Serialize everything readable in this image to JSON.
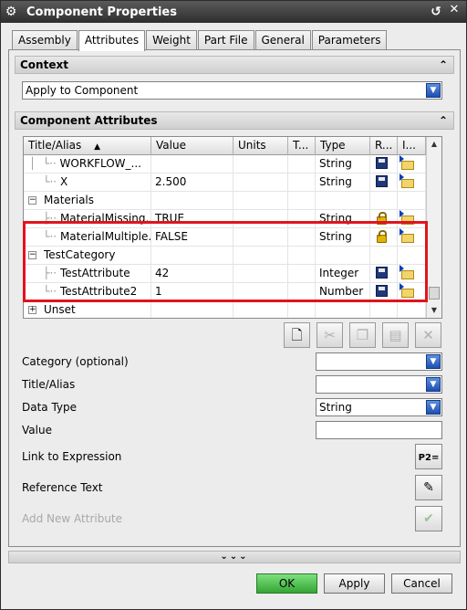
{
  "window": {
    "title": "Component Properties"
  },
  "tabs": [
    {
      "label": "Assembly"
    },
    {
      "label": "Attributes"
    },
    {
      "label": "Weight"
    },
    {
      "label": "Part File"
    },
    {
      "label": "General"
    },
    {
      "label": "Parameters"
    }
  ],
  "context": {
    "header": "Context",
    "apply_to": "Apply to Component"
  },
  "attributes_group": {
    "header": "Component Attributes",
    "columns": [
      "Title/Alias",
      "Value",
      "Units",
      "T...",
      "Type",
      "R...",
      "I..."
    ],
    "rows": [
      {
        "title": "WORKFLOW_...",
        "value": "",
        "type": "String"
      },
      {
        "title": "X",
        "value": "2.500",
        "type": "String"
      },
      {
        "title": "Materials",
        "value": "",
        "type": ""
      },
      {
        "title": "MaterialMissing...",
        "value": "TRUE",
        "type": "String"
      },
      {
        "title": "MaterialMultiple...",
        "value": "FALSE",
        "type": "String"
      },
      {
        "title": "TestCategory",
        "value": "",
        "type": ""
      },
      {
        "title": "TestAttribute",
        "value": "42",
        "type": "Integer"
      },
      {
        "title": "TestAttribute2",
        "value": "1",
        "type": "Number"
      },
      {
        "title": "Unset",
        "value": "",
        "type": ""
      }
    ]
  },
  "form": {
    "category_label": "Category (optional)",
    "title_label": "Title/Alias",
    "datatype_label": "Data Type",
    "datatype_value": "String",
    "value_label": "Value",
    "link_label": "Link to Expression",
    "reference_label": "Reference Text",
    "add_label": "Add New Attribute"
  },
  "buttons": {
    "ok": "OK",
    "apply": "Apply",
    "cancel": "Cancel"
  },
  "colors": {
    "highlight": "#e0141e",
    "ok_button": "#35a535",
    "combo_arrow": "#1f4fb0"
  }
}
